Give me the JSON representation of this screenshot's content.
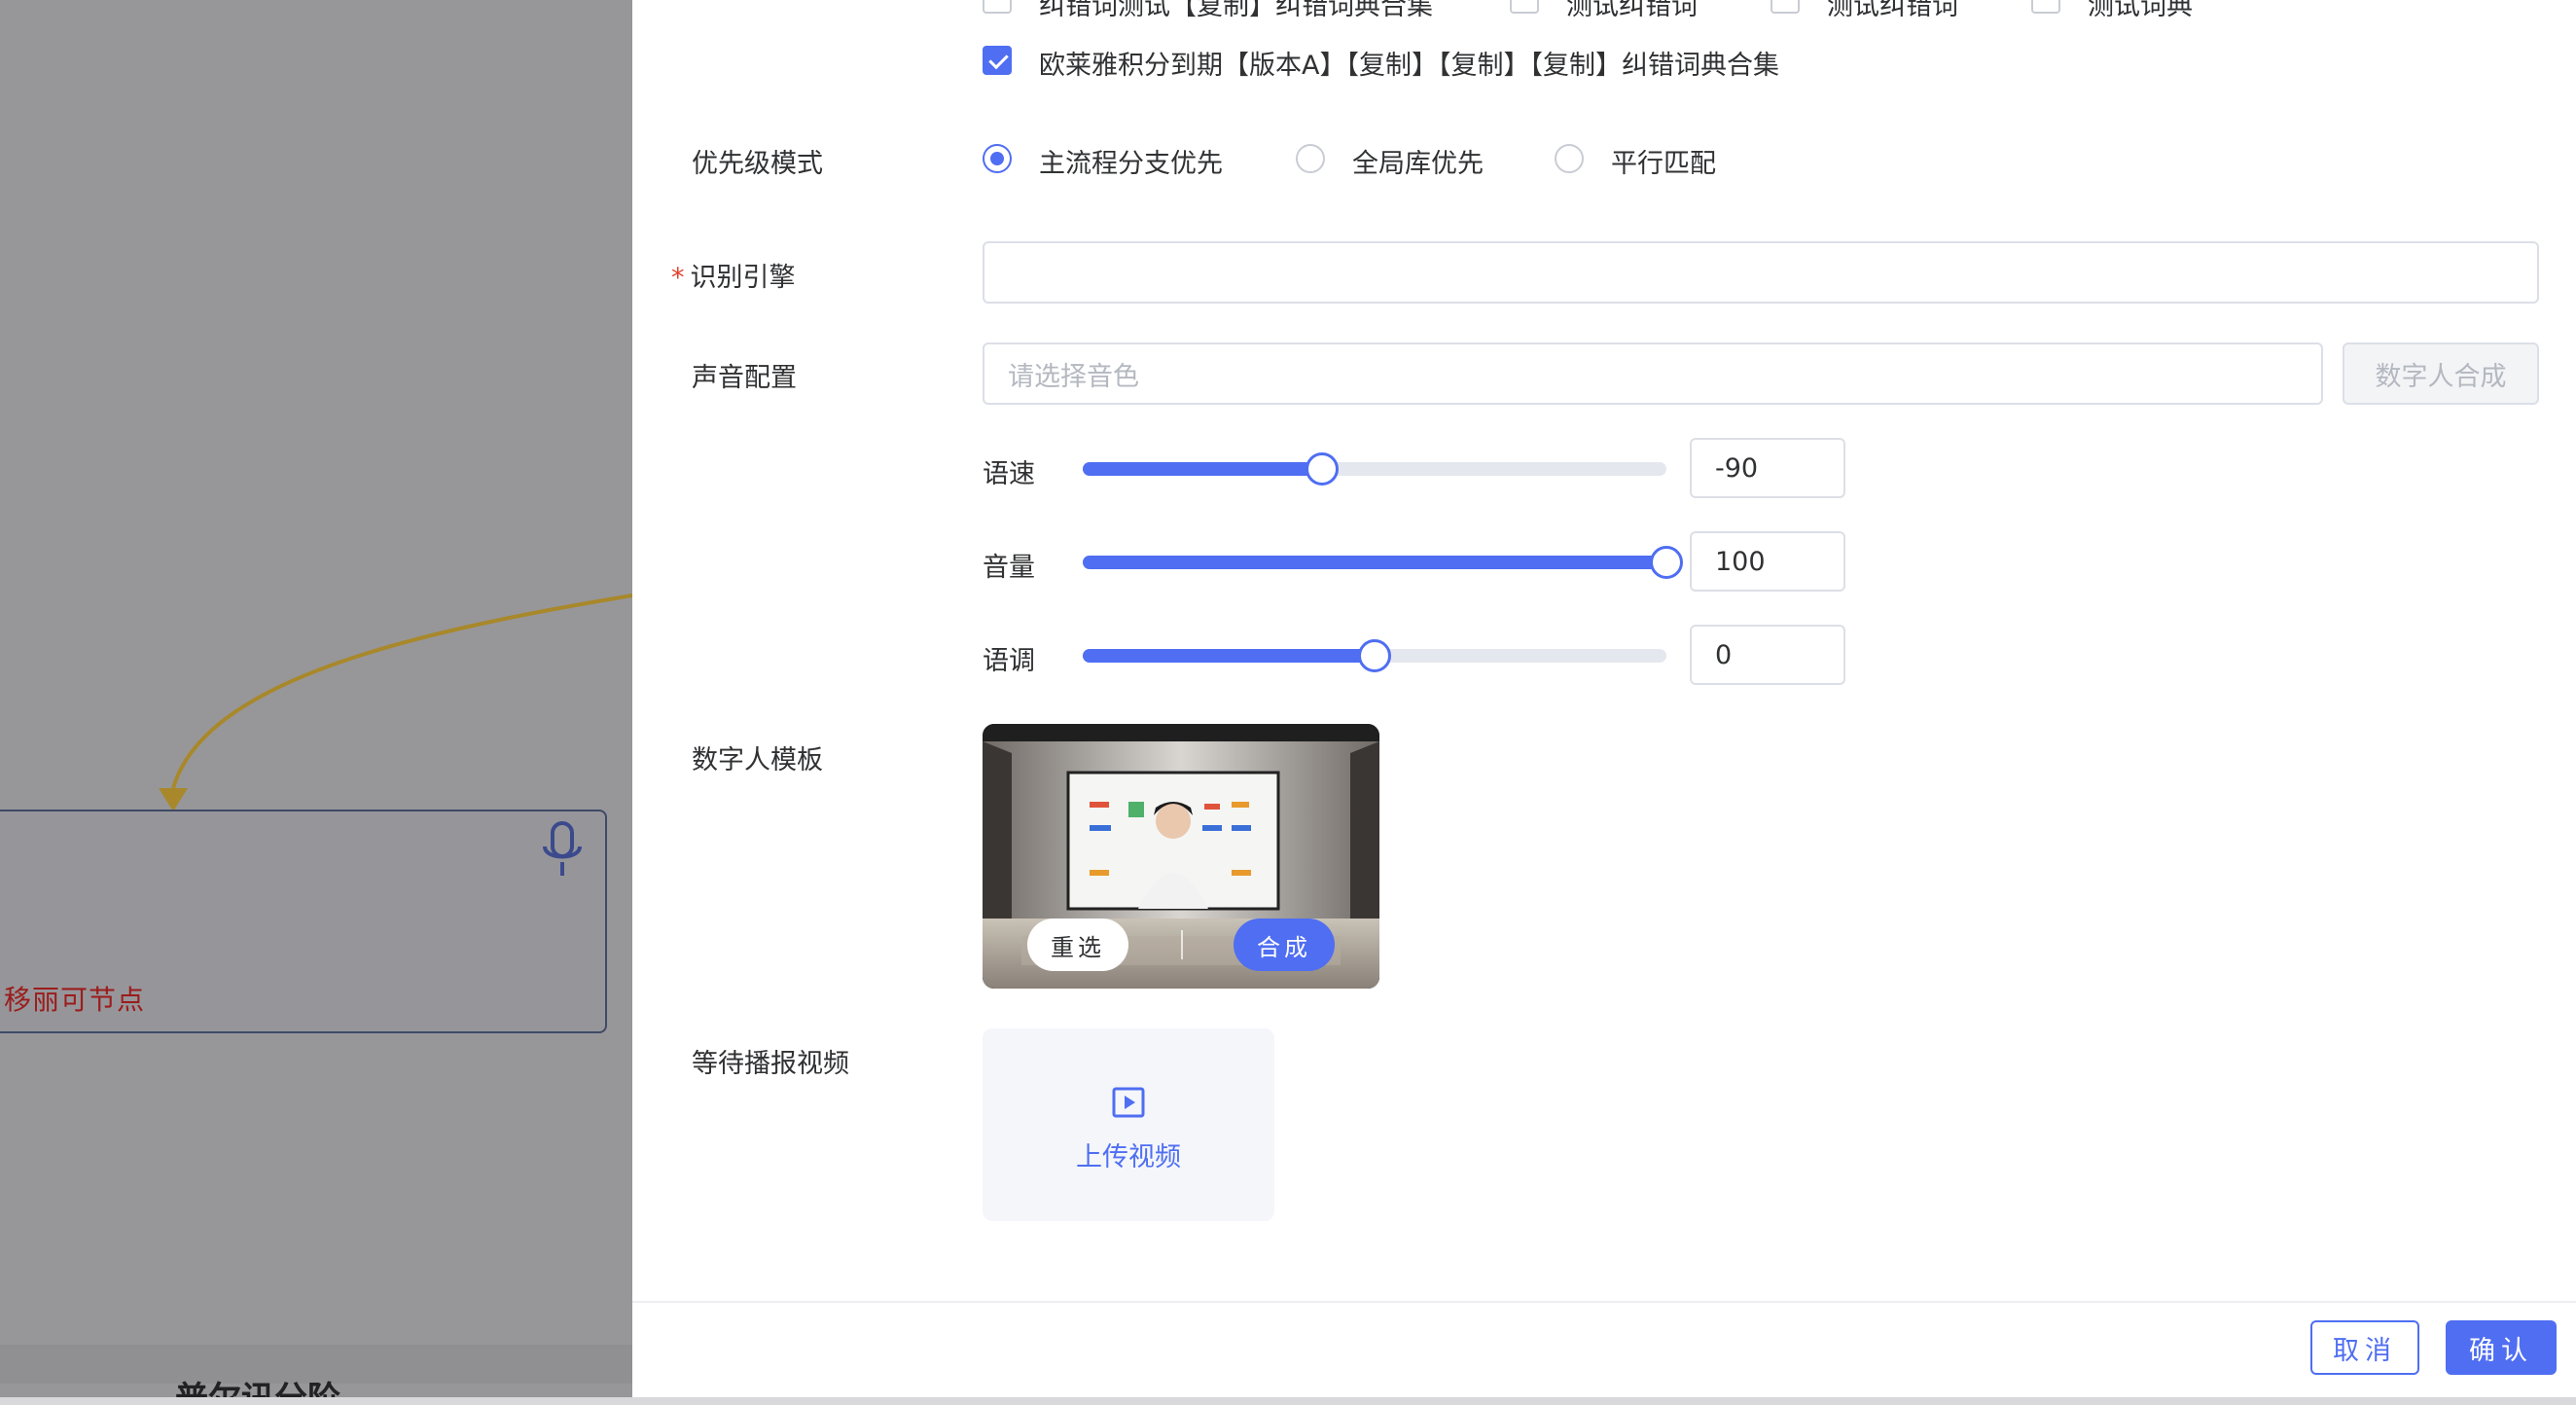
{
  "background": {
    "node_text": "移丽可节点",
    "bottom_text": "普尔讯分阶"
  },
  "dictionaries": {
    "partial_items": [
      {
        "label": "纠错词测试【复制】纠错词典合集",
        "checked": false
      },
      {
        "label": "测试纠错词",
        "checked": false
      },
      {
        "label": "测试纠错词",
        "checked": false
      },
      {
        "label": "测试词典",
        "checked": false
      }
    ],
    "selected_item": {
      "label": "欧莱雅积分到期【版本A】【复制】【复制】【复制】纠错词典合集",
      "checked": true
    }
  },
  "priority": {
    "label": "优先级模式",
    "options": [
      {
        "label": "主流程分支优先",
        "checked": true
      },
      {
        "label": "全局库优先",
        "checked": false
      },
      {
        "label": "平行匹配",
        "checked": false
      }
    ]
  },
  "engine": {
    "label": "识别引擎",
    "required_mark": "*",
    "value": ""
  },
  "voice": {
    "label": "声音配置",
    "placeholder": "请选择音色",
    "synth_button": "数字人合成",
    "sliders": [
      {
        "label": "语速",
        "value": "-90",
        "fraction": 0.41
      },
      {
        "label": "音量",
        "value": "100",
        "fraction": 1.0
      },
      {
        "label": "语调",
        "value": "0",
        "fraction": 0.5
      }
    ]
  },
  "template": {
    "label": "数字人模板",
    "reselect_button": "重选",
    "compose_button": "合成"
  },
  "waiting_video": {
    "label": "等待播报视频",
    "upload_label": "上传视频"
  },
  "footer": {
    "cancel_label": "取消",
    "confirm_label": "确认"
  },
  "colors": {
    "accent": "#4f6ef2",
    "required": "#e0412f",
    "mask": "#97979a"
  }
}
